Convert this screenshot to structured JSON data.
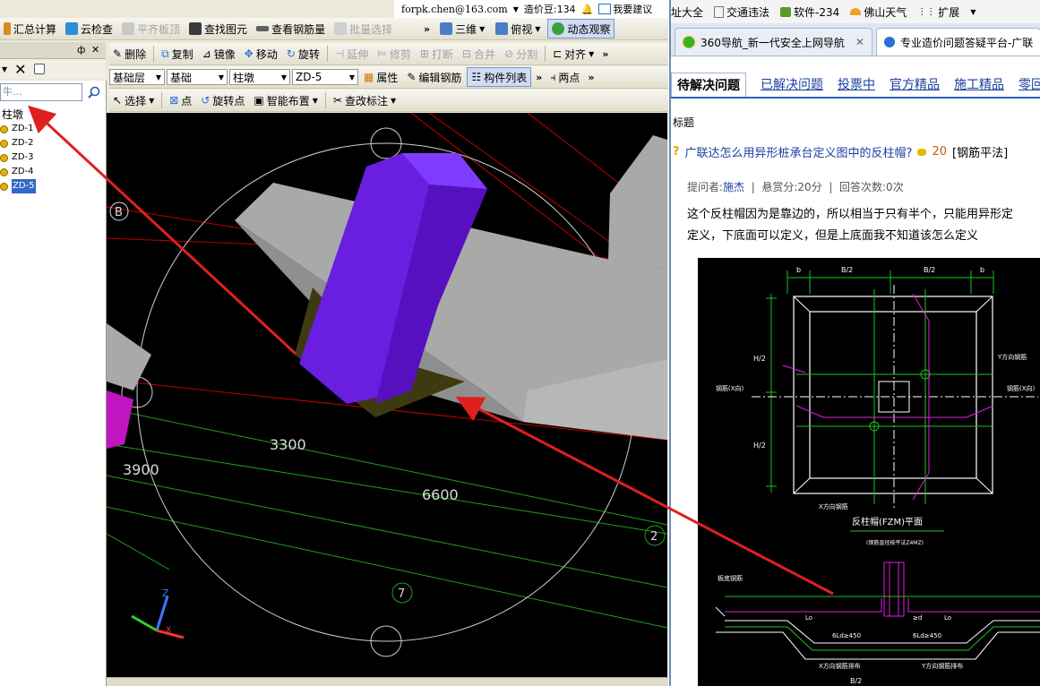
{
  "app": {
    "toolbar1": {
      "summary": "汇总计算",
      "cloud_check": "云检查",
      "flush_slab": "平齐板顶",
      "find_element": "查找图元",
      "view_rebar": "查看钢筋量",
      "batch_select": "批量选择",
      "view_3d": "三维",
      "top_view": "俯视",
      "dynamic_view": "动态观察"
    },
    "title_info": {
      "email": "forpk.chen@163.com",
      "beans": "造价豆:134",
      "suggest": "我要建议"
    },
    "toolbar2": {
      "delete": "删除",
      "copy": "复制",
      "mirror": "镜像",
      "move": "移动",
      "rotate": "旋转",
      "extend": "延伸",
      "trim": "修剪",
      "break": "打断",
      "merge": "合并",
      "split": "分割",
      "align": "对齐"
    },
    "toolbar3": {
      "layer": "基础层",
      "category": "基础",
      "type": "柱墩",
      "element": "ZD-5",
      "properties": "属性",
      "edit_rebar": "编辑钢筋",
      "element_list": "构件列表",
      "two_points": "两点"
    },
    "toolbar4": {
      "select": "选择",
      "point": "点",
      "rotate_point": "旋转点",
      "smart_layout": "智能布置",
      "edit_label": "查改标注"
    },
    "panel": {
      "pin": "ф",
      "close": "✕",
      "search_placeholder": "牛...",
      "tree_root": "柱墩",
      "items": [
        "ZD-1",
        "ZD-2",
        "ZD-3",
        "ZD-4",
        "ZD-5"
      ]
    },
    "viewport": {
      "dim1": "3300",
      "dim2": "3900",
      "dim3": "6600",
      "axis_b": "B",
      "axis_2": "2",
      "axis_7": "7"
    }
  },
  "browser": {
    "bookmarks": [
      {
        "label": "址大全",
        "icon": "none"
      },
      {
        "label": "交通违法",
        "icon": "page-icon"
      },
      {
        "label": "软件-234",
        "icon": "software-icon"
      },
      {
        "label": "佛山天气",
        "icon": "weather-icon"
      },
      {
        "label": "扩展",
        "icon": "grid-icon"
      }
    ],
    "tabs": [
      {
        "label": "360导航_新一代安全上网导航",
        "active": false
      },
      {
        "label": "专业造价问题答疑平台-广联",
        "active": true
      }
    ],
    "nav_tabs": [
      {
        "label": "待解决问题",
        "current": true
      },
      {
        "label": "已解决问题",
        "current": false
      },
      {
        "label": "投票中",
        "current": false
      },
      {
        "label": "官方精品",
        "current": false
      },
      {
        "label": "施工精品",
        "current": false
      },
      {
        "label": "零回",
        "current": false
      }
    ],
    "section_header": "标题",
    "question": {
      "title": "广联达怎么用异形桩承台定义图中的反柱帽?",
      "points": "20",
      "category": "[钢筋平法]"
    },
    "meta": {
      "asker_label": "提问者:",
      "asker": "施杰",
      "reward": "悬赏分:20分",
      "answers": "回答次数:0次"
    },
    "body_line1": "这个反柱帽因为是靠边的，所以相当于只有半个，只能用异形定",
    "body_line2": "定义，下底面可以定义，但是上底面我不知道该怎么定义",
    "cad": {
      "b": "b",
      "b_half": "B/2",
      "h_half": "H/2",
      "h": "h",
      "y_rebar": "Y方向钢筋",
      "x_rebar": "X方向钢筋",
      "x_dir_left": "钢筋(X向)",
      "x_dir_right": "钢筋(X向)",
      "plan_title": "反柱帽(FZM)平面",
      "plan_sub": "(钢筋直径按平法Z4MZ)",
      "tie_label": "板底钢筋",
      "lo": "Lo",
      "ld": "≥d",
      "dim_450a": "6Ld≥450",
      "dim_450b": "6Ld≥450",
      "x_bottom": "X方向钢筋排布",
      "y_bottom": "Y方向钢筋排布",
      "bottom_b": "B/2"
    }
  },
  "colors": {
    "column": "#6a1ee0",
    "slab": "#a9a9a9",
    "arrow": "#e02020",
    "grid_green": "#1f9e1f",
    "grid_red": "#c00000",
    "magenta": "#e020e0"
  }
}
